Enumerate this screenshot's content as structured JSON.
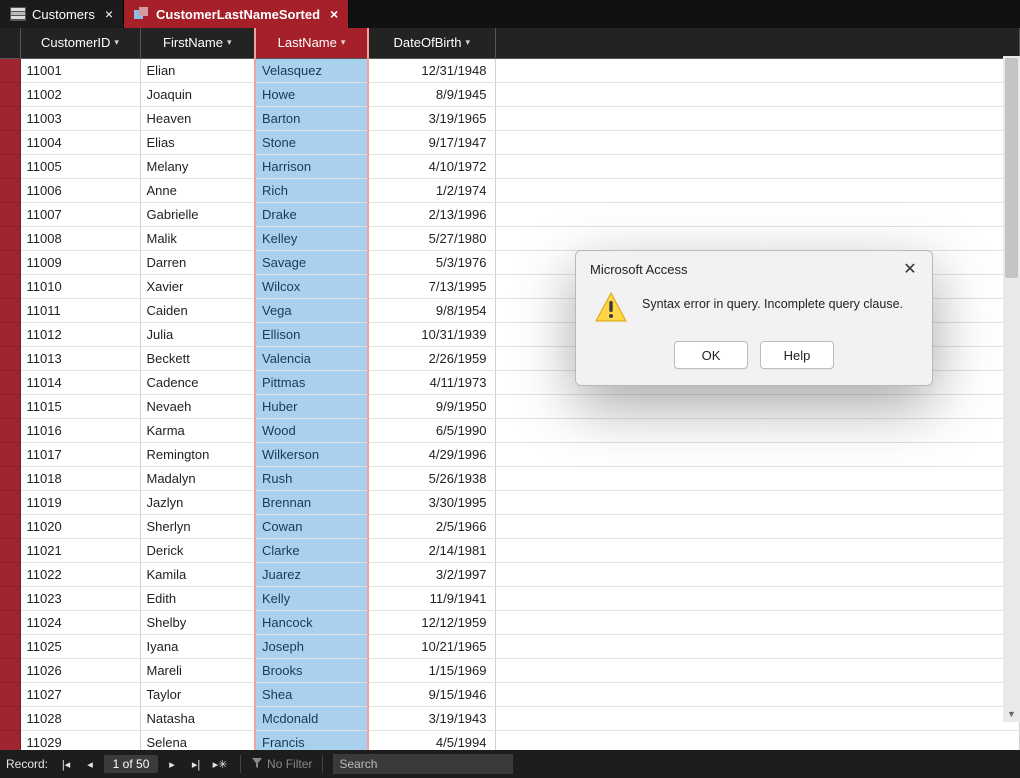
{
  "tabs": [
    {
      "label": "Customers",
      "active": false
    },
    {
      "label": "CustomerLastNameSorted",
      "active": true
    }
  ],
  "columns": {
    "CustomerID": "CustomerID",
    "FirstName": "FirstName",
    "LastName": "LastName",
    "DateOfBirth": "DateOfBirth"
  },
  "rows": [
    {
      "id": "11001",
      "first": "Elian",
      "last": "Velasquez",
      "dob": "12/31/1948"
    },
    {
      "id": "11002",
      "first": "Joaquin",
      "last": "Howe",
      "dob": "8/9/1945"
    },
    {
      "id": "11003",
      "first": "Heaven",
      "last": "Barton",
      "dob": "3/19/1965"
    },
    {
      "id": "11004",
      "first": "Elias",
      "last": "Stone",
      "dob": "9/17/1947"
    },
    {
      "id": "11005",
      "first": "Melany",
      "last": "Harrison",
      "dob": "4/10/1972"
    },
    {
      "id": "11006",
      "first": "Anne",
      "last": "Rich",
      "dob": "1/2/1974"
    },
    {
      "id": "11007",
      "first": "Gabrielle",
      "last": "Drake",
      "dob": "2/13/1996"
    },
    {
      "id": "11008",
      "first": "Malik",
      "last": "Kelley",
      "dob": "5/27/1980"
    },
    {
      "id": "11009",
      "first": "Darren",
      "last": "Savage",
      "dob": "5/3/1976"
    },
    {
      "id": "11010",
      "first": "Xavier",
      "last": "Wilcox",
      "dob": "7/13/1995"
    },
    {
      "id": "11011",
      "first": "Caiden",
      "last": "Vega",
      "dob": "9/8/1954"
    },
    {
      "id": "11012",
      "first": "Julia",
      "last": "Ellison",
      "dob": "10/31/1939"
    },
    {
      "id": "11013",
      "first": "Beckett",
      "last": "Valencia",
      "dob": "2/26/1959"
    },
    {
      "id": "11014",
      "first": "Cadence",
      "last": "Pittmas",
      "dob": "4/11/1973"
    },
    {
      "id": "11015",
      "first": "Nevaeh",
      "last": "Huber",
      "dob": "9/9/1950"
    },
    {
      "id": "11016",
      "first": "Karma",
      "last": "Wood",
      "dob": "6/5/1990"
    },
    {
      "id": "11017",
      "first": "Remington",
      "last": "Wilkerson",
      "dob": "4/29/1996"
    },
    {
      "id": "11018",
      "first": "Madalyn",
      "last": "Rush",
      "dob": "5/26/1938"
    },
    {
      "id": "11019",
      "first": "Jazlyn",
      "last": "Brennan",
      "dob": "3/30/1995"
    },
    {
      "id": "11020",
      "first": "Sherlyn",
      "last": "Cowan",
      "dob": "2/5/1966"
    },
    {
      "id": "11021",
      "first": "Derick",
      "last": "Clarke",
      "dob": "2/14/1981"
    },
    {
      "id": "11022",
      "first": "Kamila",
      "last": "Juarez",
      "dob": "3/2/1997"
    },
    {
      "id": "11023",
      "first": "Edith",
      "last": "Kelly",
      "dob": "11/9/1941"
    },
    {
      "id": "11024",
      "first": "Shelby",
      "last": "Hancock",
      "dob": "12/12/1959"
    },
    {
      "id": "11025",
      "first": "Iyana",
      "last": "Joseph",
      "dob": "10/21/1965"
    },
    {
      "id": "11026",
      "first": "Mareli",
      "last": "Brooks",
      "dob": "1/15/1969"
    },
    {
      "id": "11027",
      "first": "Taylor",
      "last": "Shea",
      "dob": "9/15/1946"
    },
    {
      "id": "11028",
      "first": "Natasha",
      "last": "Mcdonald",
      "dob": "3/19/1943"
    },
    {
      "id": "11029",
      "first": "Selena",
      "last": "Francis",
      "dob": "4/5/1994"
    }
  ],
  "navbar": {
    "record_label": "Record:",
    "position": "1 of 50",
    "no_filter": "No Filter",
    "search_placeholder": "Search"
  },
  "dialog": {
    "title": "Microsoft Access",
    "message": "Syntax error in query. Incomplete query clause.",
    "ok": "OK",
    "help": "Help"
  }
}
